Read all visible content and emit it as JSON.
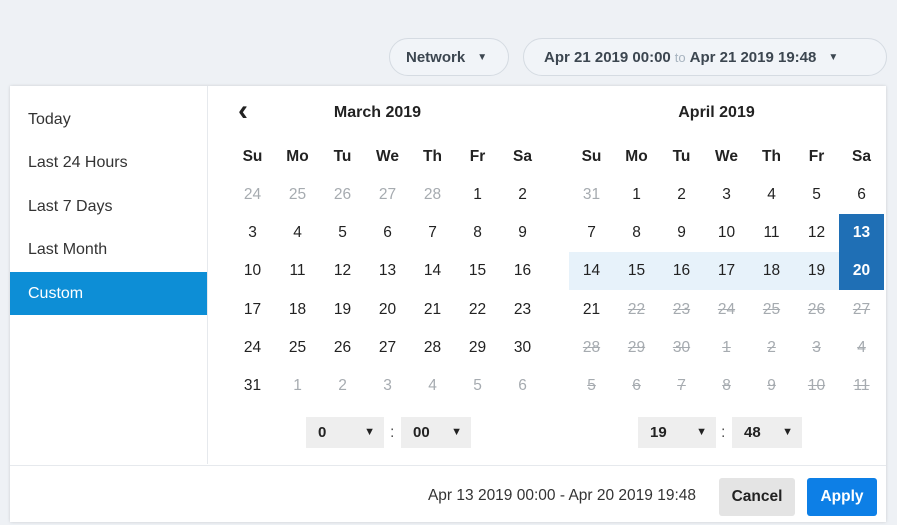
{
  "toolbar": {
    "network_label": "Network",
    "range_start": "Apr 21 2019 00:00",
    "range_to": "to",
    "range_end": "Apr 21 2019 19:48"
  },
  "presets": [
    "Today",
    "Last 24 Hours",
    "Last 7 Days",
    "Last Month",
    "Custom"
  ],
  "active_preset": "Custom",
  "weekdays": [
    "Su",
    "Mo",
    "Tu",
    "We",
    "Th",
    "Fr",
    "Sa"
  ],
  "calendars": [
    {
      "title": "March 2019",
      "has_prev": true,
      "days": [
        {
          "d": "24",
          "s": "muted"
        },
        {
          "d": "25",
          "s": "muted"
        },
        {
          "d": "26",
          "s": "muted"
        },
        {
          "d": "27",
          "s": "muted"
        },
        {
          "d": "28",
          "s": "muted"
        },
        {
          "d": "1",
          "s": ""
        },
        {
          "d": "2",
          "s": ""
        },
        {
          "d": "3",
          "s": ""
        },
        {
          "d": "4",
          "s": ""
        },
        {
          "d": "5",
          "s": ""
        },
        {
          "d": "6",
          "s": ""
        },
        {
          "d": "7",
          "s": ""
        },
        {
          "d": "8",
          "s": ""
        },
        {
          "d": "9",
          "s": ""
        },
        {
          "d": "10",
          "s": ""
        },
        {
          "d": "11",
          "s": ""
        },
        {
          "d": "12",
          "s": ""
        },
        {
          "d": "13",
          "s": ""
        },
        {
          "d": "14",
          "s": ""
        },
        {
          "d": "15",
          "s": ""
        },
        {
          "d": "16",
          "s": ""
        },
        {
          "d": "17",
          "s": ""
        },
        {
          "d": "18",
          "s": ""
        },
        {
          "d": "19",
          "s": ""
        },
        {
          "d": "20",
          "s": ""
        },
        {
          "d": "21",
          "s": ""
        },
        {
          "d": "22",
          "s": ""
        },
        {
          "d": "23",
          "s": ""
        },
        {
          "d": "24",
          "s": ""
        },
        {
          "d": "25",
          "s": ""
        },
        {
          "d": "26",
          "s": ""
        },
        {
          "d": "27",
          "s": ""
        },
        {
          "d": "28",
          "s": ""
        },
        {
          "d": "29",
          "s": ""
        },
        {
          "d": "30",
          "s": ""
        },
        {
          "d": "31",
          "s": ""
        },
        {
          "d": "1",
          "s": "muted"
        },
        {
          "d": "2",
          "s": "muted"
        },
        {
          "d": "3",
          "s": "muted"
        },
        {
          "d": "4",
          "s": "muted"
        },
        {
          "d": "5",
          "s": "muted"
        },
        {
          "d": "6",
          "s": "muted"
        }
      ],
      "hour": "0",
      "minute": "00"
    },
    {
      "title": "April 2019",
      "has_prev": false,
      "days": [
        {
          "d": "31",
          "s": "muted"
        },
        {
          "d": "1",
          "s": ""
        },
        {
          "d": "2",
          "s": ""
        },
        {
          "d": "3",
          "s": ""
        },
        {
          "d": "4",
          "s": ""
        },
        {
          "d": "5",
          "s": ""
        },
        {
          "d": "6",
          "s": ""
        },
        {
          "d": "7",
          "s": ""
        },
        {
          "d": "8",
          "s": ""
        },
        {
          "d": "9",
          "s": ""
        },
        {
          "d": "10",
          "s": ""
        },
        {
          "d": "11",
          "s": ""
        },
        {
          "d": "12",
          "s": ""
        },
        {
          "d": "13",
          "s": "sel"
        },
        {
          "d": "14",
          "s": "inrange"
        },
        {
          "d": "15",
          "s": "inrange"
        },
        {
          "d": "16",
          "s": "inrange"
        },
        {
          "d": "17",
          "s": "inrange"
        },
        {
          "d": "18",
          "s": "inrange"
        },
        {
          "d": "19",
          "s": "inrange"
        },
        {
          "d": "20",
          "s": "sel"
        },
        {
          "d": "21",
          "s": ""
        },
        {
          "d": "22",
          "s": "strike"
        },
        {
          "d": "23",
          "s": "strike"
        },
        {
          "d": "24",
          "s": "strike"
        },
        {
          "d": "25",
          "s": "strike"
        },
        {
          "d": "26",
          "s": "strike"
        },
        {
          "d": "27",
          "s": "strike"
        },
        {
          "d": "28",
          "s": "strike"
        },
        {
          "d": "29",
          "s": "strike"
        },
        {
          "d": "30",
          "s": "strike"
        },
        {
          "d": "1",
          "s": "strike"
        },
        {
          "d": "2",
          "s": "strike"
        },
        {
          "d": "3",
          "s": "strike"
        },
        {
          "d": "4",
          "s": "strike"
        },
        {
          "d": "5",
          "s": "strike"
        },
        {
          "d": "6",
          "s": "strike"
        },
        {
          "d": "7",
          "s": "strike"
        },
        {
          "d": "8",
          "s": "strike"
        },
        {
          "d": "9",
          "s": "strike"
        },
        {
          "d": "10",
          "s": "strike"
        },
        {
          "d": "11",
          "s": "strike"
        }
      ],
      "hour": "19",
      "minute": "48"
    }
  ],
  "footer": {
    "summary": "Apr 13 2019 00:00 - Apr 20 2019 19:48",
    "cancel_label": "Cancel",
    "apply_label": "Apply"
  },
  "colors": {
    "accent": "#0d8ed6",
    "selected": "#1f6fb5",
    "in_range": "#e7f2fa",
    "apply": "#0d7fe6"
  }
}
